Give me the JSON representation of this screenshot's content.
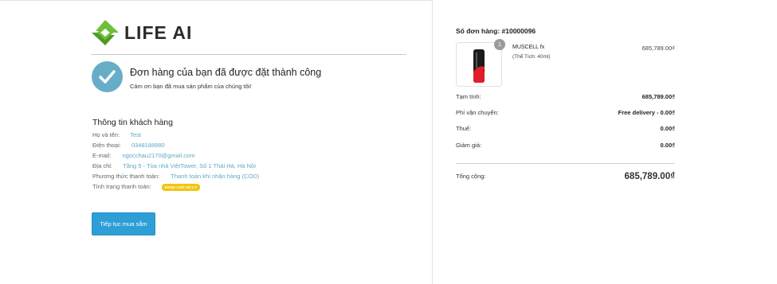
{
  "brand": {
    "name": "LIFE AI"
  },
  "confirmation": {
    "title": "Đơn hàng của bạn đã được đặt thành công",
    "subtitle": "Cảm ơn bạn đã mua sản phẩm của chúng tôi!"
  },
  "customer": {
    "heading": "Thông tin khách hàng",
    "rows": [
      {
        "label": "Họ và tên:",
        "value": "Test"
      },
      {
        "label": "Điện thoại:",
        "value": "0348188980"
      },
      {
        "label": "E-mail:",
        "value": "ngocchau2170@gmail.com"
      },
      {
        "label": "Địa chỉ:",
        "value": "Tầng 5 - Tòa nhà ViệtTower, Số 1 Thái Hà, Hà Nội"
      },
      {
        "label": "Phương thức thanh toán:",
        "value": "Thanh toán khi nhận hàng (COD)"
      },
      {
        "label": "Tình trạng thanh toán:",
        "value": "ĐANG CHỜ XỬ LÝ"
      }
    ]
  },
  "continue_button": "Tiếp tục mua sắm",
  "order": {
    "number_label": "Số đơn hàng: #10000096",
    "item": {
      "quantity": "1",
      "name": "MUSCELL fx",
      "variant": "(Thể Tích: 40ml)",
      "price": "685,789.00₫"
    },
    "summary": [
      {
        "label": "Tạm tính:",
        "value": "685,789.00₫"
      },
      {
        "label": "Phí vận chuyển:",
        "value": "Free delivery - 0.00₫"
      },
      {
        "label": "Thuế:",
        "value": "0.00₫"
      },
      {
        "label": "Giảm giá:",
        "value": "0.00₫"
      }
    ],
    "total_label": "Tổng cộng:",
    "total_value": "685,789.00₫"
  },
  "colors": {
    "accent": "#68adc8",
    "button": "#2d9ed6",
    "badge": "#f1c40f",
    "logo_green": "#6fbf3b"
  }
}
